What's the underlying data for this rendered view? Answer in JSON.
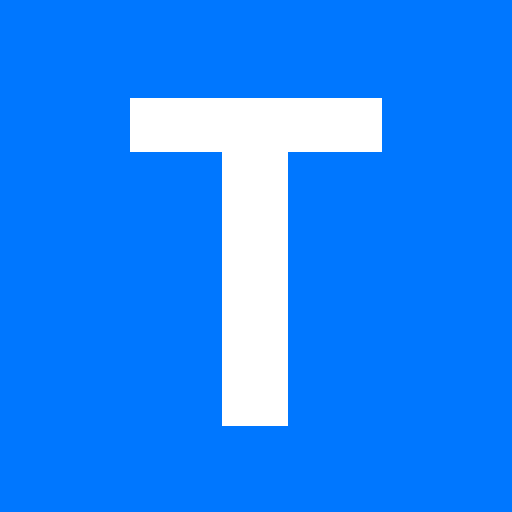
{
  "logo": {
    "letter": "T",
    "background_color": "#0077ff",
    "glyph_color": "#ffffff"
  }
}
